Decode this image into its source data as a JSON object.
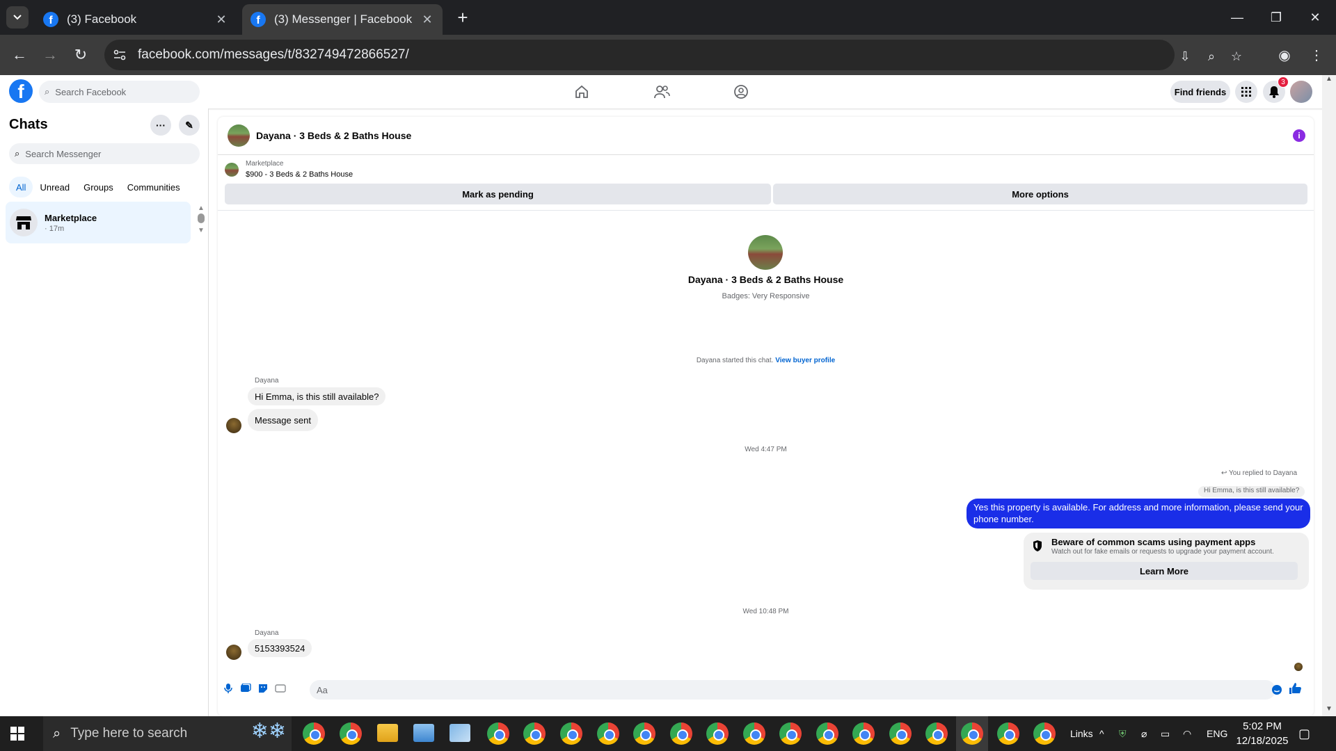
{
  "browser": {
    "tabs": [
      {
        "title": "(3) Facebook",
        "active": false
      },
      {
        "title": "(3) Messenger | Facebook",
        "active": true
      }
    ],
    "url": "facebook.com/messages/t/832749472866527/",
    "new_tab": "+"
  },
  "fb": {
    "search_placeholder": "Search Facebook",
    "find_friends": "Find friends",
    "notif_count": "3"
  },
  "sidebar": {
    "title": "Chats",
    "search_placeholder": "Search Messenger",
    "filters": [
      "All",
      "Unread",
      "Groups",
      "Communities"
    ],
    "chat": {
      "name": "Marketplace",
      "time": "· 17m"
    }
  },
  "conversation": {
    "header_title": "Dayana · 3 Beds & 2 Baths House",
    "listing_label": "Marketplace",
    "listing_price": "$900 - 3 Beds & 2 Baths House",
    "mark_pending": "Mark as pending",
    "more_options": "More options",
    "profile_name": "Dayana · 3 Beds & 2 Baths House",
    "profile_badge": "Badges: Very Responsive",
    "started_text": "Dayana started this chat.",
    "view_profile": "View buyer profile",
    "sender1": "Dayana",
    "msg1": "Hi Emma, is this still available?",
    "msg2": "Message sent",
    "time1": "Wed 4:47 PM",
    "replied_to": "You replied to Dayana",
    "reply_quote": "Hi Emma, is this still available?",
    "out_msg": "Yes this property is available. For address and more information, please send your phone number.",
    "warn_title": "Beware of common scams using payment apps",
    "warn_sub": "Watch out for fake emails or requests to upgrade your payment account.",
    "learn_more": "Learn More",
    "time2": "Wed 10:48 PM",
    "sender2": "Dayana",
    "msg3": "5153393524",
    "composer_placeholder": "Aa"
  },
  "taskbar": {
    "search_placeholder": "Type here to search",
    "links": "Links",
    "lang": "ENG",
    "time": "5:02 PM",
    "date": "12/18/2025"
  }
}
